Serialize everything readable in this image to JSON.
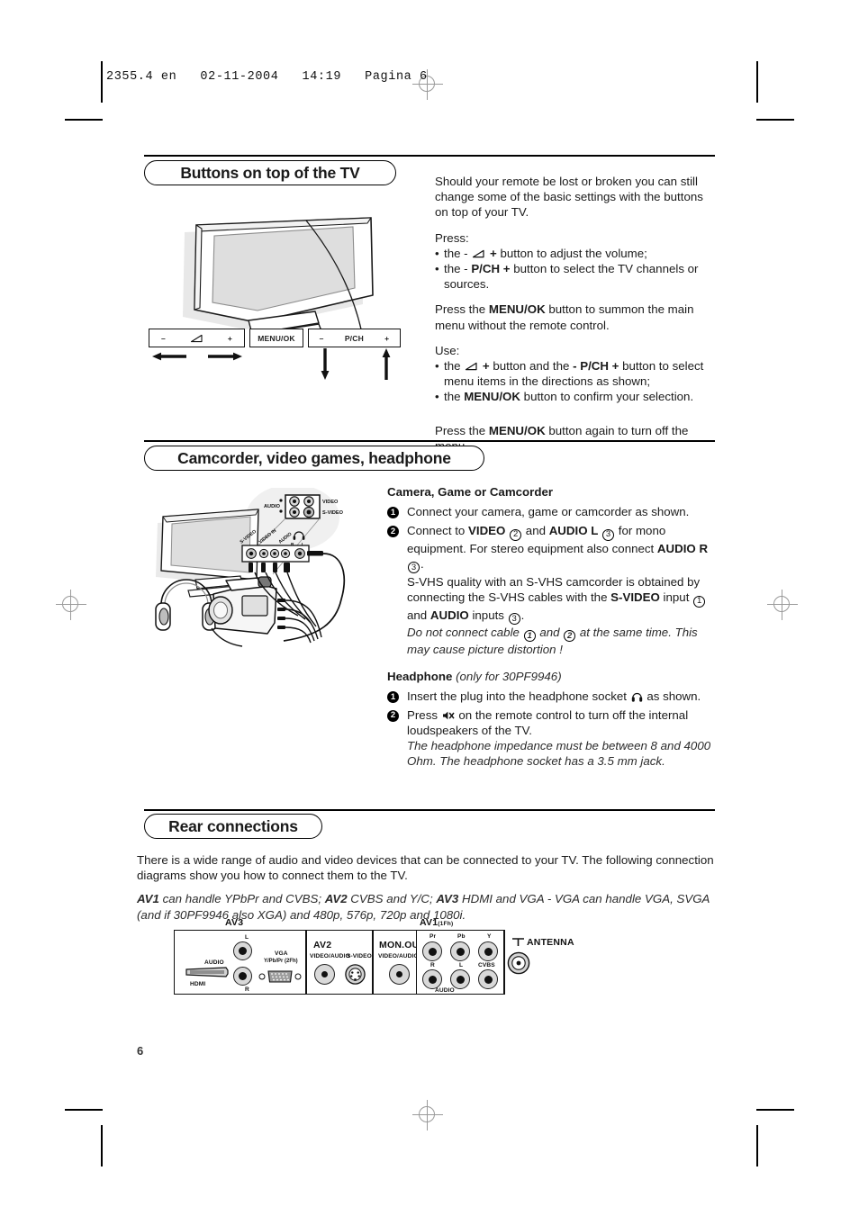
{
  "document": {
    "file_header": "2355.4 en   02-11-2004   14:19   Pagina 6",
    "page_number": "6"
  },
  "sections": {
    "buttons_on_top": {
      "heading": "Buttons on top of the TV",
      "intro": "Should your remote be lost or broken you can still change some of the basic settings with the buttons on top of your TV.",
      "press_label": "Press:",
      "press_bullets": [
        {
          "pre": "the - ",
          "icon": "volume-wedge-icon",
          "post_bold": " + ",
          "post": "button to adjust the volume;"
        },
        {
          "pre": "the - ",
          "bold": "P/CH +",
          "post": " button to select the TV channels or sources."
        }
      ],
      "menu_paragraph_pre": "Press the ",
      "menu_paragraph_bold": "MENU/OK",
      "menu_paragraph_post": " button to summon the main menu without the remote control.",
      "use_label": "Use:",
      "use_bullets": [
        {
          "pre": "the ",
          "icon": "volume-wedge-icon",
          "mid_bold": " + ",
          "mid": "button and the ",
          "bold2": "- P/CH +",
          "post": " button to select menu items in the directions as shown;"
        },
        {
          "pre": "the ",
          "bold": "MENU/OK",
          "post": " button to confirm your selection."
        }
      ],
      "turn_off_pre": "Press the ",
      "turn_off_bold": "MENU/OK",
      "turn_off_post": " button again to turn off the menu.",
      "button_bar": {
        "volume_minus": "–",
        "volume_icon": "volume-wedge-icon",
        "volume_plus": "+",
        "menu_label": "MENU/OK",
        "pch_minus": "–",
        "pch_label": "P/CH",
        "pch_plus": "+"
      }
    },
    "camcorder": {
      "heading": "Camcorder, video games, headphone",
      "camera_title": "Camera, Game or Camcorder",
      "steps": [
        {
          "num": "1",
          "text": "Connect your camera, game or camcorder as shown."
        },
        {
          "num": "2",
          "text": "Connect to VIDEO (2) and AUDIO L (3) for mono equipment. For stereo equipment also connect AUDIO R (3)."
        }
      ],
      "step2_parts": {
        "a": "Connect to ",
        "video": "VIDEO",
        "ref_2": "2",
        "and": " and ",
        "audio_l": "AUDIO L",
        "ref_3": "3",
        "mono": " for mono equipment. For stereo equipment also connect ",
        "audio_r": "AUDIO R",
        "ref_3b": "3",
        "period": "."
      },
      "svhs_pre": "S-VHS quality with an S-VHS camcorder is obtained by connecting the S-VHS cables with the ",
      "svhs_bold": "S-VIDEO",
      "svhs_mid": " input ",
      "svhs_ref1": "1",
      "svhs_and": " and ",
      "svhs_audio": "AUDIO",
      "svhs_inputs": " inputs ",
      "svhs_ref3": "3",
      "svhs_end": ".",
      "warning_pre": "Do not connect cable ",
      "warning_ref1": "1",
      "warning_and": " and ",
      "warning_ref2": "2",
      "warning_post": " at the same time. This may cause picture distortion !",
      "headphone_title": "Headphone",
      "headphone_note": "(only for 30PF9946)",
      "hp_step1_pre": "Insert the plug into the headphone socket ",
      "hp_step1_icon": "headphone-icon",
      "hp_step1_post": " as shown.",
      "hp_step2_pre": "Press ",
      "hp_step2_icon": "mute-icon",
      "hp_step2_post": " on the remote control to turn off the internal loudspeakers of the TV.",
      "hp_italic": "The headphone impedance must be between 8 and 4000 Ohm. The headphone socket has a 3.5 mm jack.",
      "diagram_labels": {
        "audio": "AUDIO",
        "video": "VIDEO",
        "s_video": "S-VIDEO",
        "side_s_video": "S-VIDEO",
        "side_video_in": "VIDEO IN",
        "side_audio": "AUDIO",
        "side_r": "R",
        "side_l": "L"
      }
    },
    "rear_connections": {
      "heading": "Rear connections",
      "intro": "There is a wide range of audio and video devices that can be connected to your TV. The following connection diagrams show you how to connect them to the TV.",
      "av_note": {
        "av1": "AV1",
        "av1_text": " can handle YPbPr and CVBS;  ",
        "av2": "AV2",
        "av2_text": " CVBS and Y/C;  ",
        "av3": "AV3",
        "av3_text": " HDMI and VGA - VGA can handle VGA, SVGA (and if 30PF9946 also XGA) and 480p, 576p, 720p and 1080i."
      },
      "panels": {
        "av3": {
          "title": "AV3",
          "hdmi": "HDMI",
          "audio": "AUDIO",
          "l": "L",
          "r": "R",
          "vga": "VGA",
          "vga_sub": "Y/Pb/Pr (2Fh)"
        },
        "av2": {
          "title": "AV2",
          "video_audio": "VIDEO/AUDIO",
          "s_video": "S-VIDEO"
        },
        "mon_out": {
          "title": "MON.OUT",
          "video_audio": "VIDEO/AUDIO"
        },
        "av1": {
          "title": "AV1",
          "sub": "(1Fh)",
          "pr": "Pr",
          "pb": "Pb",
          "y": "Y",
          "r": "R",
          "l": "L",
          "cvbs": "CVBS",
          "audio": "AUDIO"
        },
        "antenna": {
          "label": "ANTENNA"
        }
      }
    }
  }
}
